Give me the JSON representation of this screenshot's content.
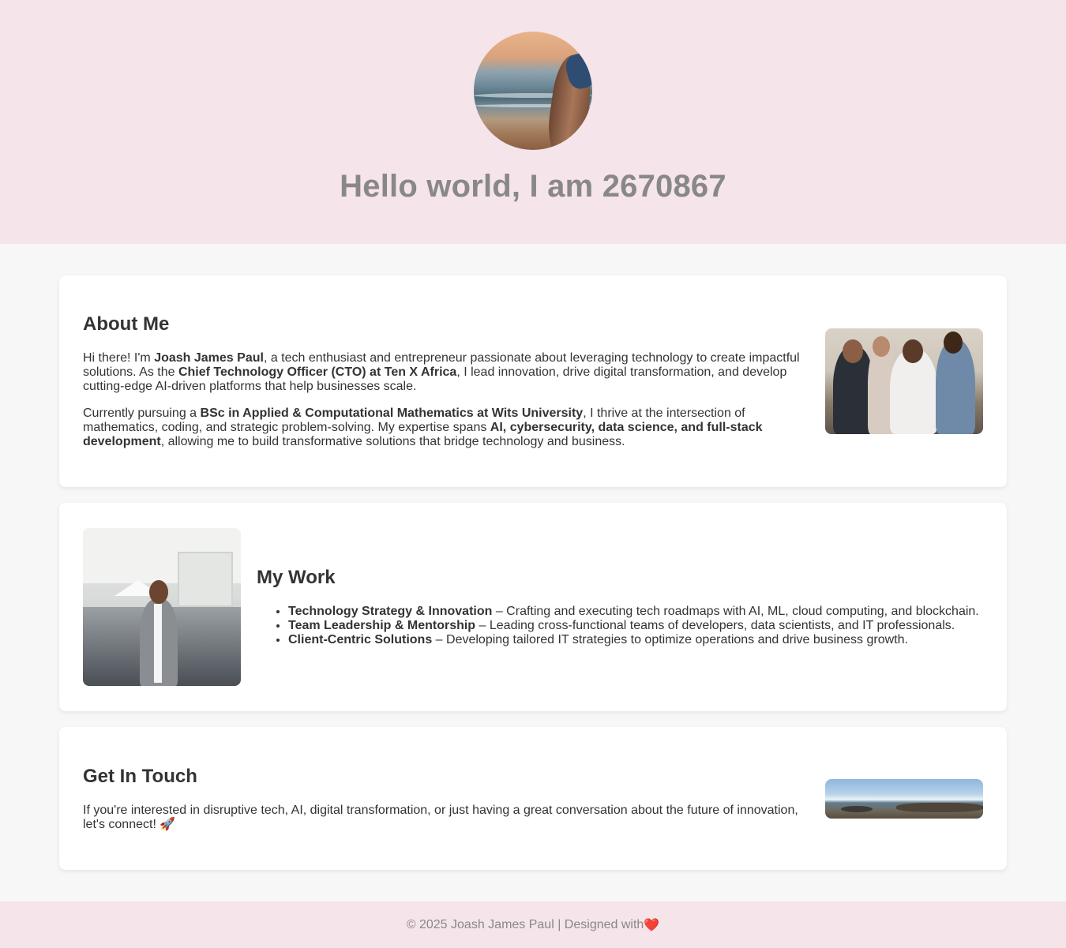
{
  "hero": {
    "title": "Hello world, I am 2670867"
  },
  "about": {
    "heading": "About Me",
    "p1": {
      "t1": "Hi there! I'm ",
      "b1": "Joash James Paul",
      "t2": ", a tech enthusiast and entrepreneur passionate about leveraging technology to create impactful solutions. As the ",
      "b2": "Chief Technology Officer (CTO) at Ten X Africa",
      "t3": ", I lead innovation, drive digital transformation, and develop cutting-edge AI-driven platforms that help businesses scale."
    },
    "p2": {
      "t1": "Currently pursuing a ",
      "b1": "BSc in Applied & Computational Mathematics at Wits University",
      "t2": ", I thrive at the intersection of mathematics, coding, and strategic problem-solving. My expertise spans ",
      "b2": "AI, cybersecurity, data science, and full-stack development",
      "t3": ", allowing me to build transformative solutions that bridge technology and business."
    }
  },
  "work": {
    "heading": "My Work",
    "items": [
      {
        "title": "Technology Strategy & Innovation",
        "desc": " – Crafting and executing tech roadmaps with AI, ML, cloud computing, and blockchain."
      },
      {
        "title": "Team Leadership & Mentorship",
        "desc": " – Leading cross-functional teams of developers, data scientists, and IT professionals."
      },
      {
        "title": "Client-Centric Solutions",
        "desc": " – Developing tailored IT strategies to optimize operations and drive business growth."
      }
    ]
  },
  "contact": {
    "heading": "Get In Touch",
    "text": "If you're interested in disruptive tech, AI, digital transformation, or just having a great conversation about the future of innovation, let's connect! 🚀"
  },
  "footer": {
    "text": "© 2025 Joash James Paul | Designed with ",
    "heart": "❤️"
  },
  "colors": {
    "hero_bg": "#f6e4eb",
    "page_bg": "#f7f7f7",
    "title_gray": "#888888",
    "text_dark": "#333333"
  }
}
